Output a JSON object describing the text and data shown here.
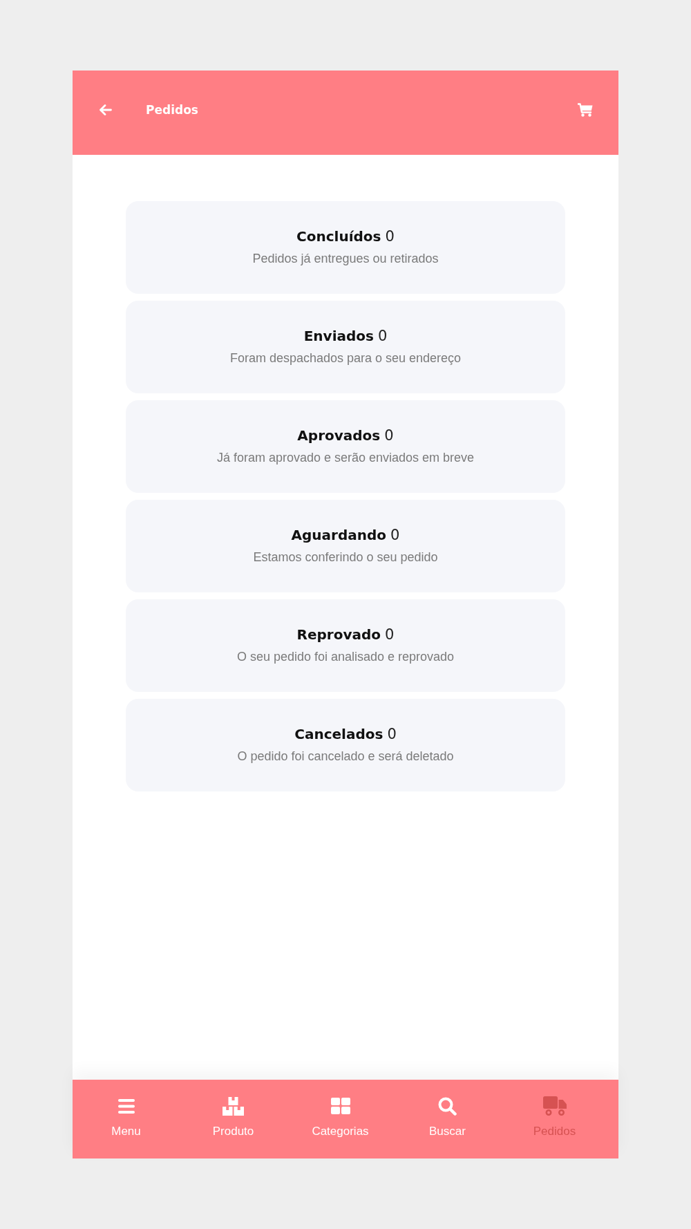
{
  "header": {
    "title": "Pedidos"
  },
  "order_statuses": [
    {
      "title": "Concluídos",
      "count": "0",
      "description": "Pedidos já entregues ou retirados"
    },
    {
      "title": "Enviados",
      "count": "0",
      "description": "Foram despachados para o seu endereço"
    },
    {
      "title": "Aprovados",
      "count": "0",
      "description": "Já foram aprovado e serão enviados em breve"
    },
    {
      "title": "Aguardando",
      "count": "0",
      "description": "Estamos conferindo o seu pedido"
    },
    {
      "title": "Reprovado",
      "count": "0",
      "description": "O seu pedido foi analisado e reprovado"
    },
    {
      "title": "Cancelados",
      "count": "0",
      "description": "O pedido foi cancelado e será deletado"
    }
  ],
  "bottom_nav": [
    {
      "kind": "menu",
      "label": "Menu",
      "selected": false
    },
    {
      "kind": "boxes",
      "label": "Produto",
      "selected": false
    },
    {
      "kind": "grid",
      "label": "Categorias",
      "selected": false
    },
    {
      "kind": "search",
      "label": "Buscar",
      "selected": false
    },
    {
      "kind": "truck",
      "label": "Pedidos",
      "selected": true
    }
  ]
}
